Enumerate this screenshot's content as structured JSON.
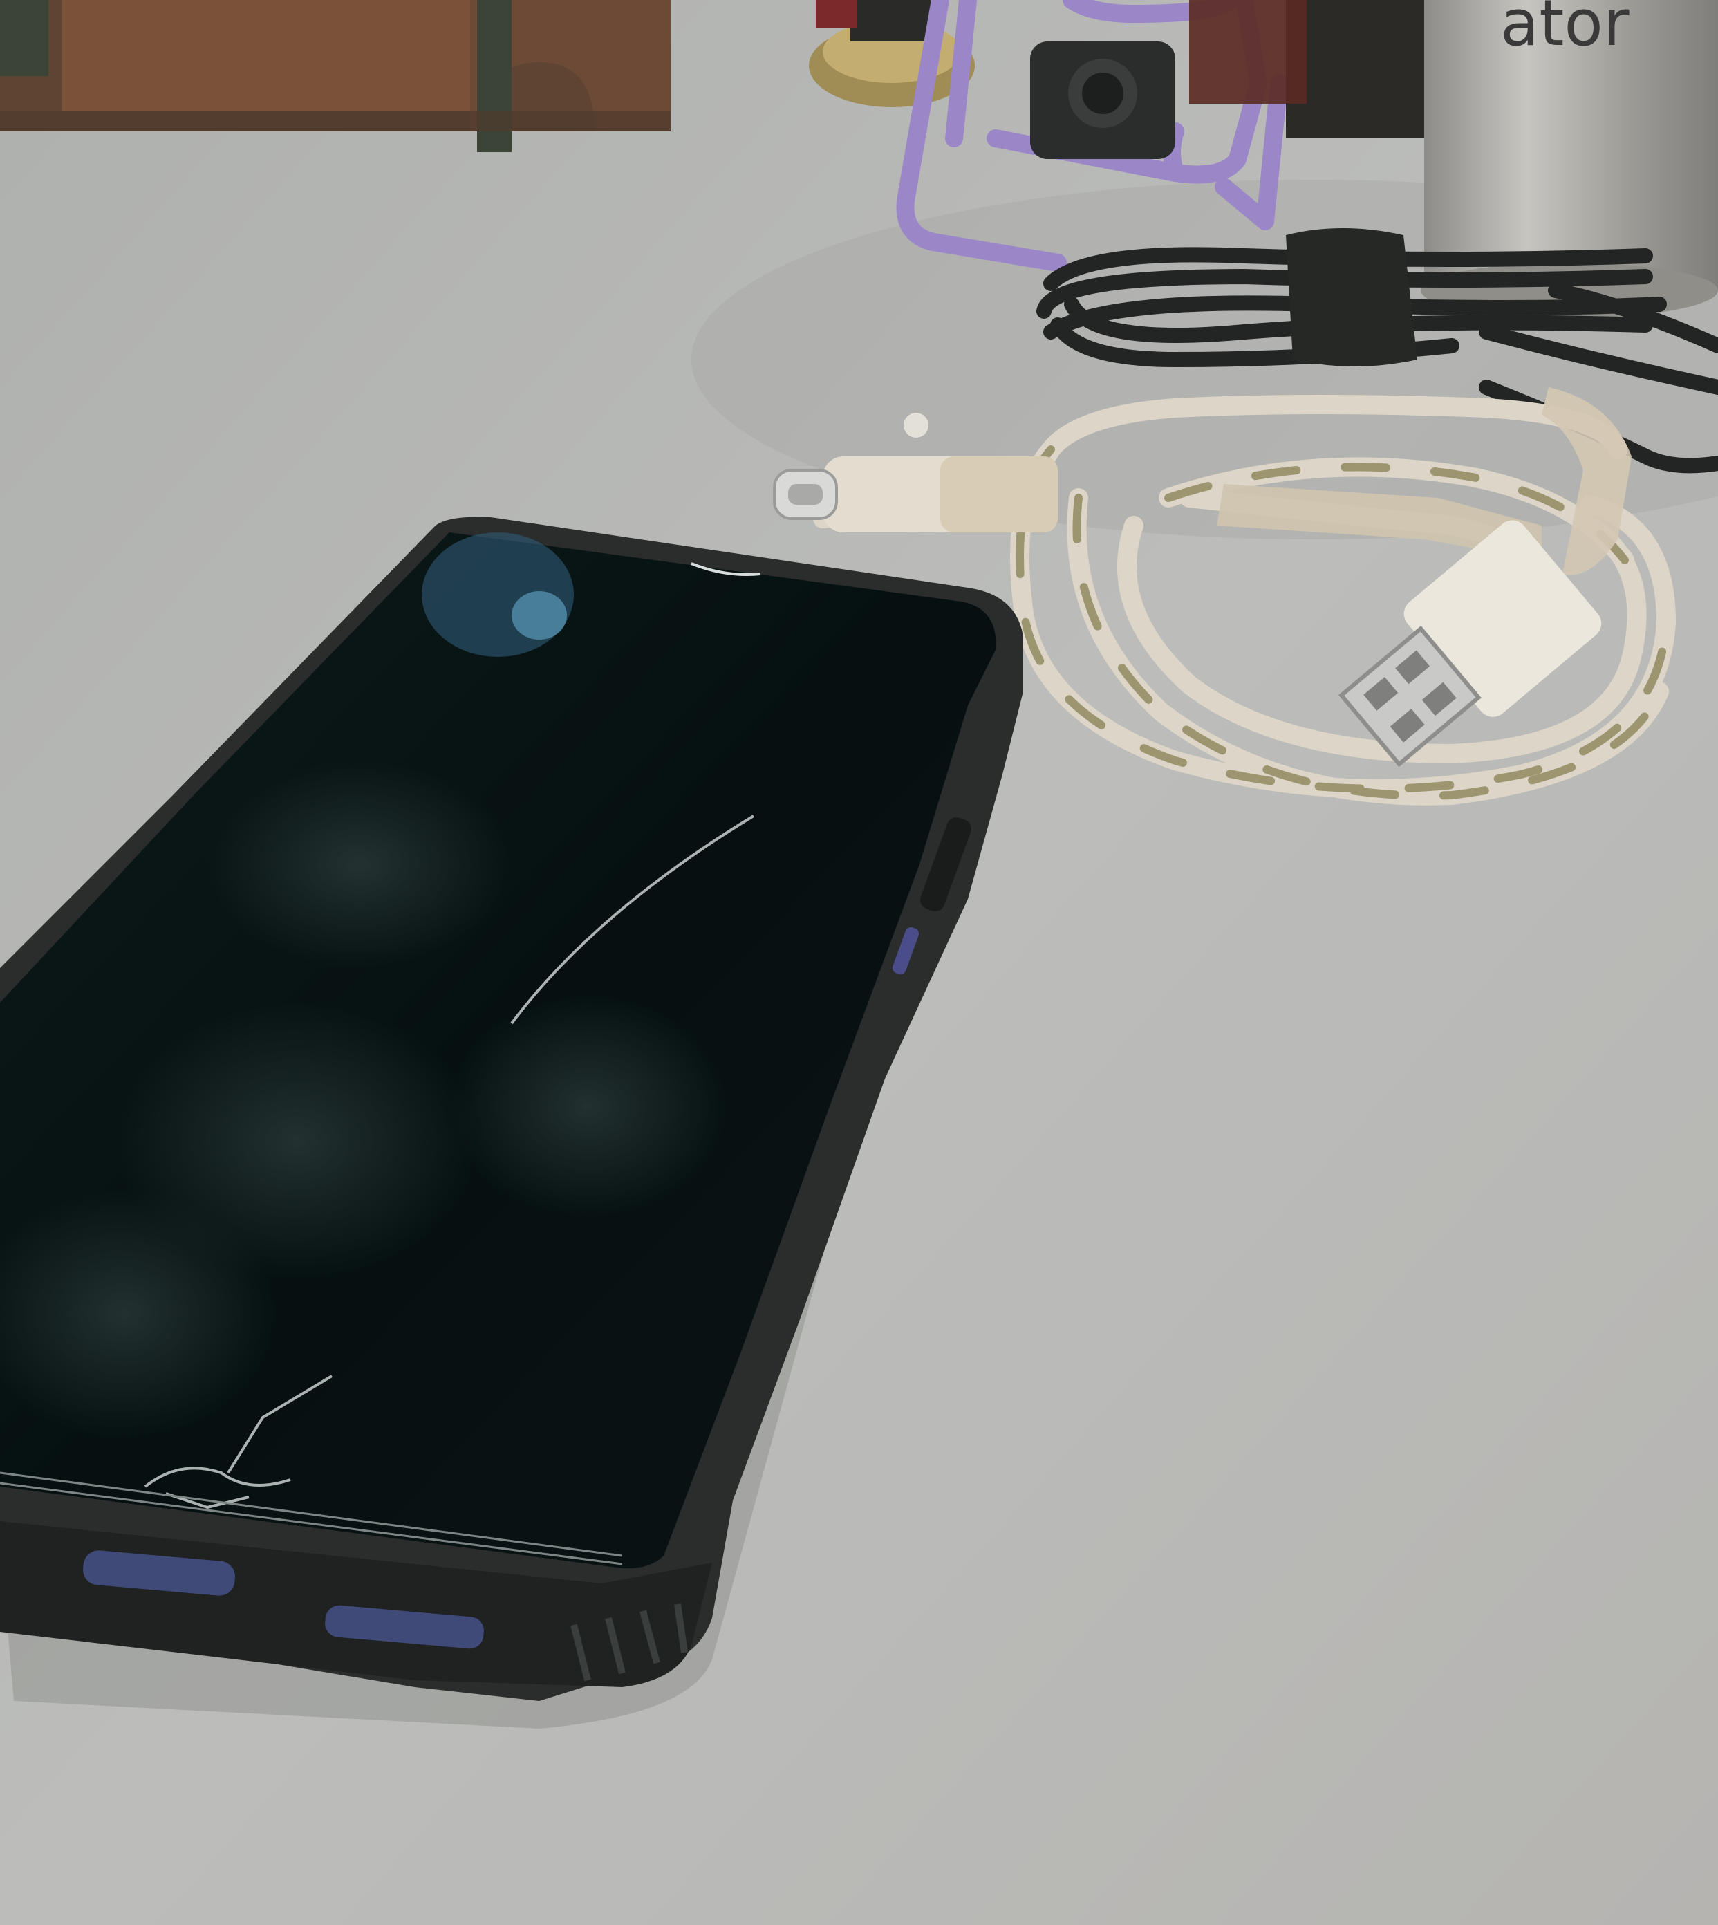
{
  "scene": {
    "can_label": "ator",
    "colors": {
      "desk": "#b9bab8",
      "desk_shadow": "#a8a9a6",
      "wood": "#6e4a35",
      "wood_dark": "#3f3a2c",
      "stand_purple": "#9b86c8",
      "metal_can": "#a9a8a3",
      "black_cable": "#222524",
      "white_cable": "#ddd6c8",
      "cable_stain": "#8c865a",
      "phone_case": "#2a2d2b",
      "phone_screen": "#07100f"
    },
    "objects": [
      "wooden-organizer",
      "phone-stand",
      "metal-canister",
      "black-cable-bundle",
      "white-usb-cable",
      "smartphone"
    ]
  }
}
